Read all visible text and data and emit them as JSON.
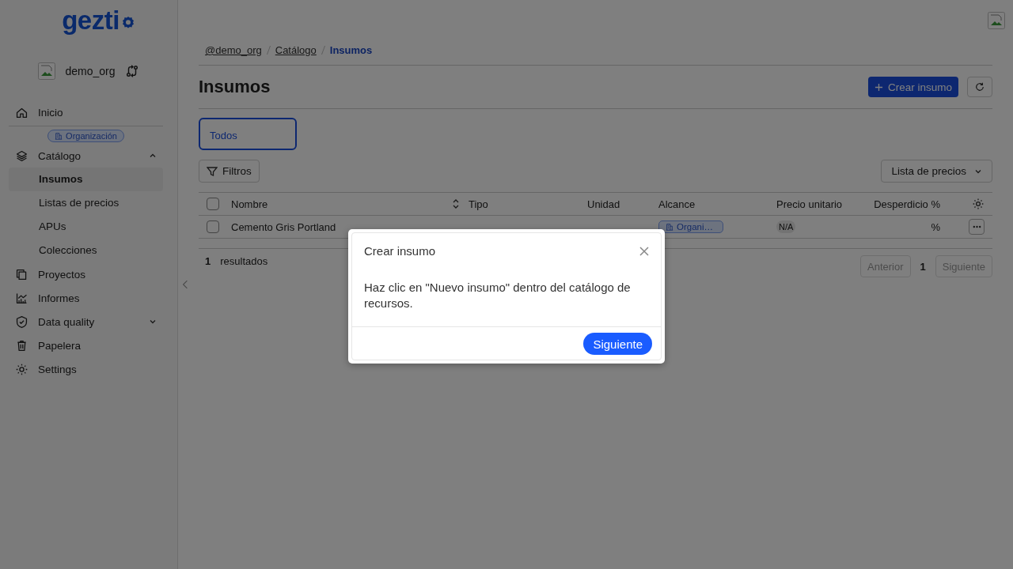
{
  "logo": {
    "text": "gezti"
  },
  "org": {
    "name": "demo_org"
  },
  "sidebar": {
    "items": [
      {
        "kind": "link",
        "label": "Inicio",
        "selected": false
      },
      {
        "kind": "badge",
        "label": "Organización"
      },
      {
        "kind": "group",
        "label": "Catálogo",
        "expanded": true,
        "children": [
          {
            "label": "Insumos",
            "selected": true
          },
          {
            "label": "Listas de precios",
            "selected": false
          },
          {
            "label": "APUs",
            "selected": false
          },
          {
            "label": "Colecciones",
            "selected": false
          }
        ]
      },
      {
        "kind": "link",
        "label": "Proyectos",
        "selected": false
      },
      {
        "kind": "link",
        "label": "Informes",
        "selected": false
      },
      {
        "kind": "group",
        "label": "Data quality",
        "expanded": false
      },
      {
        "kind": "link",
        "label": "Papelera",
        "selected": false
      },
      {
        "kind": "link",
        "label": "Settings",
        "selected": false
      }
    ]
  },
  "breadcrumb": [
    {
      "label": "@demo_org",
      "current": false
    },
    {
      "label": "Catálogo",
      "current": false
    },
    {
      "label": "Insumos",
      "current": true
    }
  ],
  "page": {
    "title": "Insumos",
    "create_button": "Crear insumo"
  },
  "tabs": [
    {
      "label": "Todos",
      "selected": true
    }
  ],
  "filters_button": "Filtros",
  "price_list_select": "Lista de precios",
  "table": {
    "columns": [
      {
        "label": "Nombre",
        "sortable": true
      },
      {
        "label": "Tipo",
        "sortable": false
      },
      {
        "label": "Unidad",
        "sortable": false
      },
      {
        "label": "Alcance",
        "sortable": false
      },
      {
        "label": "Precio unitario",
        "sortable": false
      },
      {
        "label": "Desperdicio %",
        "sortable": false
      }
    ],
    "select_all_checked": false,
    "rows": [
      {
        "checked": false,
        "name": "Cemento Gris Portland",
        "scope": "Organi…",
        "price": "N/A",
        "waste": "%"
      }
    ]
  },
  "results": {
    "count": "1",
    "label": "resultados"
  },
  "pagination": {
    "previous": "Anterior",
    "previous_disabled": true,
    "page": "1",
    "next": "Siguiente",
    "next_disabled": true
  },
  "dialog": {
    "title": "Crear insumo",
    "body": "Haz clic en \"Nuevo insumo\" dentro del catálogo de recursos.",
    "button": "Siguiente"
  }
}
